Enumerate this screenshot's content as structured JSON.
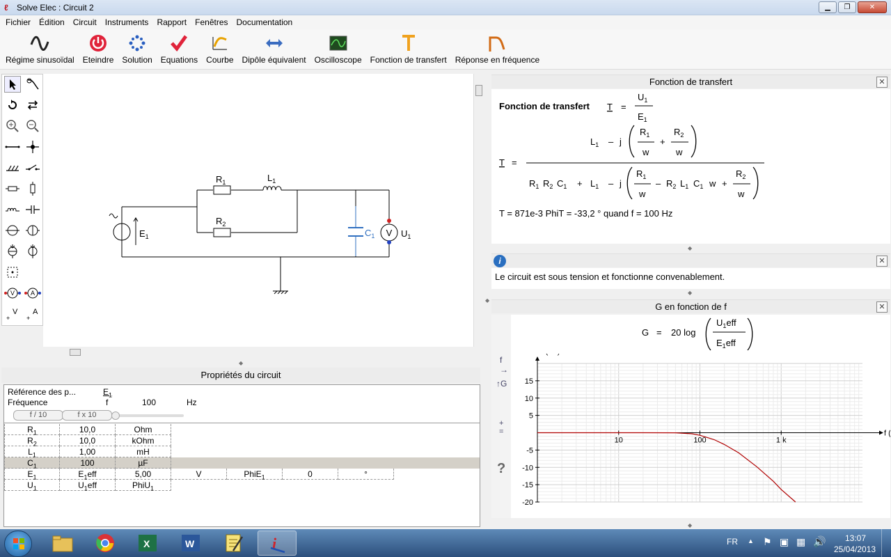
{
  "window": {
    "title": "Solve Elec : Circuit 2",
    "controls": [
      "minimize",
      "restore",
      "close"
    ]
  },
  "menu": [
    "Fichier",
    "Édition",
    "Circuit",
    "Instruments",
    "Rapport",
    "Fenêtres",
    "Documentation"
  ],
  "toolbar": [
    {
      "label": "Régime sinusoïdal",
      "icon": "sine-wave-icon"
    },
    {
      "label": "Eteindre",
      "icon": "power-icon"
    },
    {
      "label": "Solution",
      "icon": "solution-icon"
    },
    {
      "label": "Equations",
      "icon": "checkmark-icon"
    },
    {
      "label": "Courbe",
      "icon": "curve-icon"
    },
    {
      "label": "Dipôle équivalent",
      "icon": "dipole-icon"
    },
    {
      "label": "Oscilloscope",
      "icon": "oscilloscope-icon"
    },
    {
      "label": "Fonction de transfert",
      "icon": "transfer-function-icon"
    },
    {
      "label": "Réponse en fréquence",
      "icon": "frequency-response-icon"
    }
  ],
  "circuit": {
    "labels": {
      "r1": "R",
      "r1_sub": "1",
      "l1": "L",
      "l1_sub": "1",
      "r2": "R",
      "r2_sub": "2",
      "c1": "C",
      "c1_sub": "1",
      "e1": "E",
      "e1_sub": "1",
      "u1": "U",
      "u1_sub": "1",
      "v": "V"
    }
  },
  "properties": {
    "title": "Propriétés du circuit",
    "reference_label": "Référence des p...",
    "reference_value": "E",
    "reference_sub": "1",
    "frequency_label": "Fréquence",
    "frequency_symbol": "f",
    "frequency_value": "100",
    "frequency_unit": "Hz",
    "btn_div": "f / 10",
    "btn_mul": "f x 10",
    "rows": [
      {
        "name": "R",
        "sub": "1",
        "c2": "10,0",
        "c3": "Ohm"
      },
      {
        "name": "R",
        "sub": "2",
        "c2": "10,0",
        "c3": "kOhm"
      },
      {
        "name": "L",
        "sub": "1",
        "c2": "1,00",
        "c3": "mH"
      },
      {
        "name": "C",
        "sub": "1",
        "c2": "100",
        "c3": "µF"
      },
      {
        "name": "E",
        "sub": "1",
        "c2": "E",
        "c2sub": "1",
        "c2suf": "eff",
        "c3": "5,00",
        "c4": "V",
        "c5": "PhiE",
        "c5sub": "1",
        "c6": "0",
        "c7": "°"
      },
      {
        "name": "U",
        "sub": "1",
        "c2": "U",
        "c2sub": "1",
        "c2suf": "eff",
        "c3": "PhiU",
        "c3sub": "1"
      }
    ]
  },
  "transfer_panel": {
    "title": "Fonction de transfert",
    "heading": "Fonction de transfert",
    "T": "T",
    "U1": "U",
    "E1": "E",
    "sub1": "1",
    "sub2": "2",
    "L": "L",
    "R": "R",
    "C": "C",
    "j": "j",
    "w": "w",
    "minus": "–",
    "plus": "+",
    "equals": "=",
    "result": "T = 871e-3   PhiT = -33,2 °   quand f = 100 Hz"
  },
  "info_panel": {
    "message": "Le circuit est sous tension et fonctionne convenablement."
  },
  "g_panel": {
    "title": "G en fonction de f",
    "formula_G": "G",
    "formula_equals": "=",
    "formula_20log": "20 log",
    "formula_num": "U",
    "formula_num_suffix": "eff",
    "formula_den": "E",
    "formula_den_suffix": "eff",
    "side_f": "f",
    "side_G": "G",
    "side_q": "?"
  },
  "chart_data": {
    "type": "line",
    "xlabel": "f (Hz)",
    "ylabel": "G (dB)",
    "x_scale": "log",
    "xticks": [
      "10",
      "100",
      "1 k"
    ],
    "yticks": [
      "15",
      "10",
      "5",
      "-5",
      "-10",
      "-15",
      "-20"
    ],
    "xlim": [
      1,
      10000
    ],
    "ylim": [
      -20,
      20
    ],
    "grid": true,
    "series_color": "#b00000",
    "series": [
      {
        "x": [
          1,
          20,
          50,
          80,
          100,
          150,
          200,
          300,
          500,
          800,
          1000,
          1500
        ],
        "y": [
          0,
          0,
          -0.02,
          -0.3,
          -0.75,
          -2.0,
          -3.4,
          -5.8,
          -9.8,
          -14.0,
          -16.4,
          -20.0
        ]
      }
    ]
  },
  "taskbar": {
    "lang": "FR",
    "time": "13:07",
    "date": "25/04/2013",
    "apps": [
      "explorer-icon",
      "chrome-icon",
      "excel-icon",
      "word-icon",
      "notepad-icon",
      "solve-elec-icon"
    ]
  }
}
